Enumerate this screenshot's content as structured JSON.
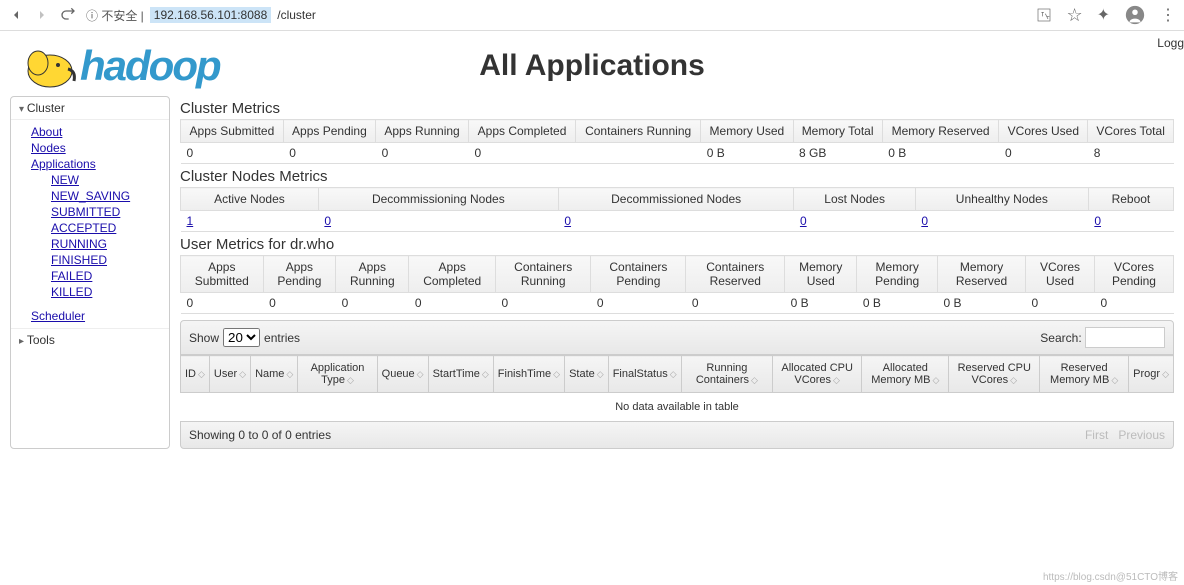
{
  "browser": {
    "secure_label": "ⓘ 不安全 |",
    "url_host": "192.168.56.101:8088",
    "url_path": "/cluster"
  },
  "header": {
    "logo_text": "hadoop",
    "page_title": "All Applications",
    "logged": "Logg"
  },
  "sidebar": {
    "cluster_label": "Cluster",
    "tools_label": "Tools",
    "links": {
      "about": "About",
      "nodes": "Nodes",
      "applications": "Applications",
      "scheduler": "Scheduler"
    },
    "app_states": [
      "NEW",
      "NEW_SAVING",
      "SUBMITTED",
      "ACCEPTED",
      "RUNNING",
      "FINISHED",
      "FAILED",
      "KILLED"
    ]
  },
  "cluster_metrics": {
    "title": "Cluster Metrics",
    "headers": [
      "Apps Submitted",
      "Apps Pending",
      "Apps Running",
      "Apps Completed",
      "Containers Running",
      "Memory Used",
      "Memory Total",
      "Memory Reserved",
      "VCores Used",
      "VCores Total"
    ],
    "values": [
      "0",
      "0",
      "0",
      "0",
      "",
      "0 B",
      "8 GB",
      "0 B",
      "0",
      "8"
    ]
  },
  "nodes_metrics": {
    "title": "Cluster Nodes Metrics",
    "headers": [
      "Active Nodes",
      "Decommissioning Nodes",
      "Decommissioned Nodes",
      "Lost Nodes",
      "Unhealthy Nodes",
      "Reboot"
    ],
    "values": [
      "1",
      "0",
      "0",
      "0",
      "0",
      "0"
    ]
  },
  "user_metrics": {
    "title": "User Metrics for dr.who",
    "headers": [
      "Apps Submitted",
      "Apps Pending",
      "Apps Running",
      "Apps Completed",
      "Containers Running",
      "Containers Pending",
      "Containers Reserved",
      "Memory Used",
      "Memory Pending",
      "Memory Reserved",
      "VCores Used",
      "VCores Pending"
    ],
    "values": [
      "0",
      "0",
      "0",
      "0",
      "0",
      "0",
      "0",
      "0 B",
      "0 B",
      "0 B",
      "0",
      "0"
    ]
  },
  "apps_table": {
    "show_label": "Show",
    "entries_label": "entries",
    "page_size": "20",
    "search_label": "Search:",
    "search_value": "",
    "columns": [
      "ID",
      "User",
      "Name",
      "Application Type",
      "Queue",
      "StartTime",
      "FinishTime",
      "State",
      "FinalStatus",
      "Running Containers",
      "Allocated CPU VCores",
      "Allocated Memory MB",
      "Reserved CPU VCores",
      "Reserved Memory MB",
      "Progr"
    ],
    "no_data": "No data available in table",
    "showing": "Showing 0 to 0 of 0 entries",
    "first": "First",
    "previous": "Previous"
  },
  "watermark": "https://blog.csdn@51CTO博客"
}
